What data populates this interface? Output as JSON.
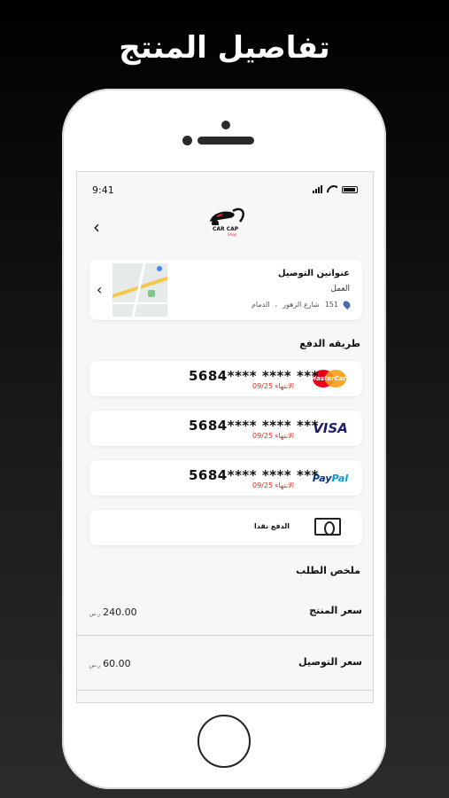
{
  "headline": "تفاصيل المنتج",
  "status_bar": {
    "time": "9:41"
  },
  "header": {
    "back_icon": "chevron-left-icon",
    "logo_text": "CAR CAP"
  },
  "address": {
    "title": "عنوانين التوصيل",
    "label": "العمل",
    "number": "151",
    "street": "شارع الزهور",
    "separator": "،",
    "city": "الدمام"
  },
  "payment": {
    "title": "طريقه الدفع",
    "cards": [
      {
        "brand": "MasterCard",
        "number": "5684**** **** ***",
        "expiry": "الانتهاء 09/25"
      },
      {
        "brand": "VISA",
        "number": "5684**** **** ***",
        "expiry": "الانتهاء 09/25"
      },
      {
        "brand": "PayPal",
        "number": "5684**** **** ***",
        "expiry": "الانتهاء 09/25"
      }
    ],
    "cash_label": "الدفع نقدا"
  },
  "summary": {
    "title": "ملخص الطلب",
    "rows": [
      {
        "label": "سعر المنتج",
        "value": "240.00",
        "currency": "ر.س"
      },
      {
        "label": "سعر التوصيل",
        "value": "60.00",
        "currency": "ر.س"
      }
    ]
  },
  "colors": {
    "accent_red": "#d32f2f",
    "visa_blue": "#1a1f71",
    "paypal_blue": "#003087",
    "paypal_light": "#009cde"
  }
}
